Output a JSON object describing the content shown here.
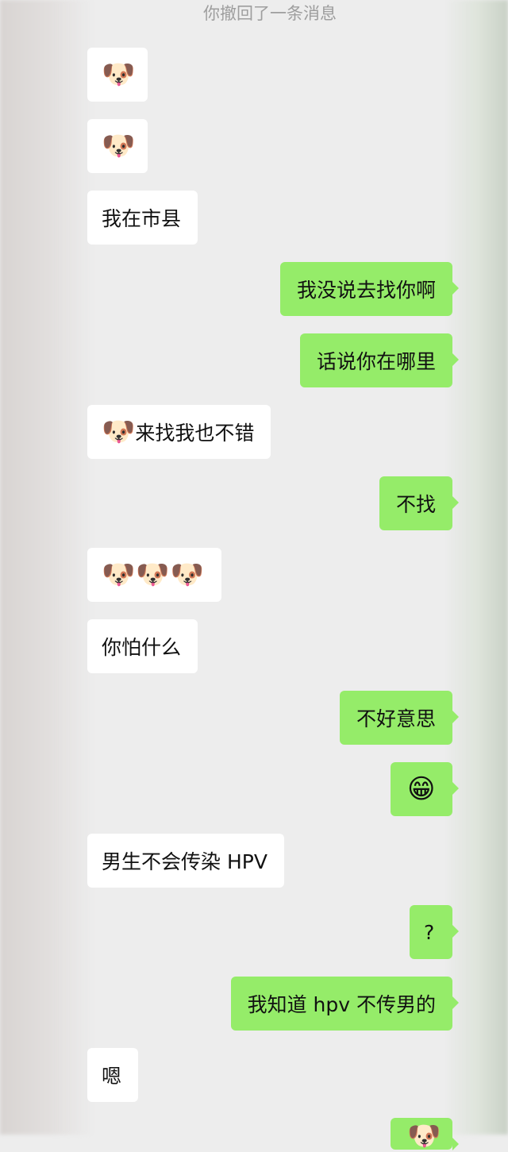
{
  "system": {
    "recall_notice": "你撤回了一条消息"
  },
  "messages": [
    {
      "id": "m1",
      "side": "in",
      "emoji": "🐶"
    },
    {
      "id": "m2",
      "side": "in",
      "emoji": "🐶"
    },
    {
      "id": "m3",
      "side": "in",
      "text": "我在市县"
    },
    {
      "id": "m4",
      "side": "out",
      "text": "我没说去找你啊"
    },
    {
      "id": "m5",
      "side": "out",
      "text": "话说你在哪里"
    },
    {
      "id": "m6",
      "side": "in",
      "emoji": "🐶",
      "text": "来找我也不错"
    },
    {
      "id": "m7",
      "side": "out",
      "text": "不找"
    },
    {
      "id": "m8",
      "side": "in",
      "emojis": [
        "🐶",
        "🐶",
        "🐶"
      ]
    },
    {
      "id": "m9",
      "side": "in",
      "text": "你怕什么"
    },
    {
      "id": "m10",
      "side": "out",
      "text": "不好意思"
    },
    {
      "id": "m11",
      "side": "out",
      "emoji": "😁"
    },
    {
      "id": "m12",
      "side": "in",
      "text": "男生不会传染 HPV"
    },
    {
      "id": "m13",
      "side": "out",
      "text": "?"
    },
    {
      "id": "m14",
      "side": "out",
      "text": "我知道 hpv 不传男的"
    },
    {
      "id": "m15",
      "side": "in",
      "text": "嗯"
    },
    {
      "id": "m16",
      "side": "out",
      "emoji": "🐶"
    }
  ]
}
